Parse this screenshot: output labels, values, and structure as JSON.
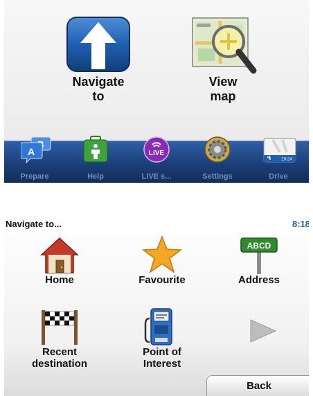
{
  "menu": {
    "navigate_label": "Navigate\nto",
    "view_map_label": "View\nmap"
  },
  "dock": [
    {
      "label": "Prepare",
      "icon": "ab-speech-bubbles-icon"
    },
    {
      "label": "Help",
      "icon": "first-aid-kit-icon"
    },
    {
      "label": "LIVE s...",
      "icon": "live-services-icon",
      "badge": "LIVE"
    },
    {
      "label": "Settings",
      "icon": "gear-icon"
    },
    {
      "label": "Drive",
      "icon": "drive-view-icon",
      "thumb_text": "10:24"
    }
  ],
  "navigate_screen": {
    "title": "Navigate to...",
    "clock": "8:18",
    "options": [
      {
        "label": "Home",
        "icon": "house-icon"
      },
      {
        "label": "Favourite",
        "icon": "star-icon"
      },
      {
        "label": "Address",
        "icon": "street-sign-icon",
        "sign_text": "ABCD"
      },
      {
        "label": "Recent\ndestination",
        "icon": "checkered-flag-icon"
      },
      {
        "label": "Point of\nInterest",
        "icon": "fuel-pump-icon"
      }
    ],
    "next_icon": "next-page-arrow-icon",
    "back_label": "Back"
  },
  "colors": {
    "dock_blue": "#1b3f78",
    "navigate_blue": "#1f5fb0",
    "clock_blue": "#1a5fb4",
    "star_orange": "#f5a623",
    "sign_green": "#2e8b2e"
  }
}
